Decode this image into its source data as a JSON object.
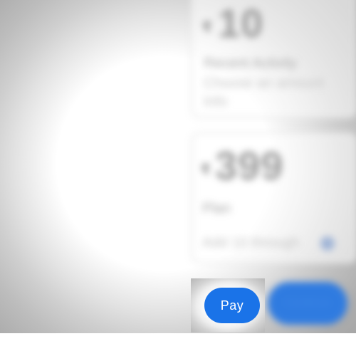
{
  "background": {
    "card_top": {
      "currency": "₹",
      "amount": "10",
      "line_1": "Recent Activity",
      "line_2": "Choose an amount",
      "line_3": "Info"
    },
    "card_bottom": {
      "currency": "₹",
      "amount": "399",
      "line_1": "Plan",
      "line_2": "Add 10 through"
    },
    "blurred_button_label": "Continue"
  },
  "pay_button": {
    "label": "Pay"
  },
  "colors": {
    "primary": "#1a73e8"
  }
}
